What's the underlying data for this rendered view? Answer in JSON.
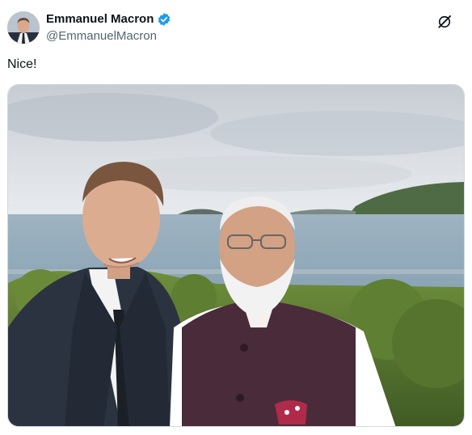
{
  "tweet": {
    "author": {
      "display_name": "Emmanuel Macron",
      "handle": "@EmmanuelMacron",
      "verified": true,
      "avatar_icon": "profile-photo"
    },
    "text": "Nice!",
    "actions": {
      "grok_icon": "grok-icon"
    },
    "media": {
      "type": "photo",
      "description_icon": "selfie-photo"
    }
  },
  "colors": {
    "text_primary": "#0f1419",
    "text_secondary": "#536471",
    "verified_blue": "#1d9bf0",
    "border": "#cfd9de"
  }
}
